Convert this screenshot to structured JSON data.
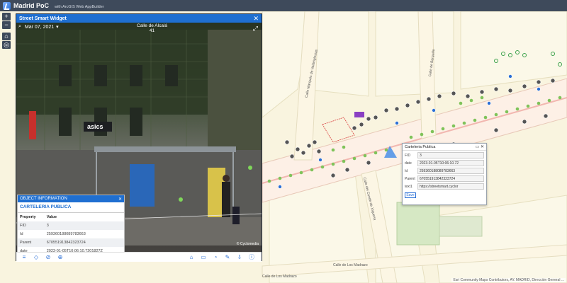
{
  "header": {
    "title": "Madrid PoC",
    "subtitle": "with ArcGIS Web AppBuilder"
  },
  "map_tools": {
    "zoom_in": "+",
    "zoom_out": "−",
    "home": "⌂",
    "locate": "◎"
  },
  "map": {
    "street_labels": [
      "Calle Marqués de Valdeiglesias",
      "Calle de Barquillo",
      "Calle de Alcalá",
      "Calle del Conde de Xiquena",
      "Calle de Los Madrazo",
      "Calle de Los Madrazo"
    ],
    "attribution": "Esri Community Maps Contributors, AY. MADRID, Dirección General ..."
  },
  "widget": {
    "title": "Street Smart Widget",
    "close": "✕",
    "date": "Mar 07, 2021",
    "address_line1": "Calle de Alcalá",
    "address_line2": "41",
    "copyright": "© Cyclomedia",
    "toolbar_left": [
      "≡",
      "◇",
      "⊘",
      "⊕"
    ],
    "toolbar_right": [
      "⌂",
      "▭",
      "◔",
      "✎",
      "⇩",
      "ⓘ"
    ]
  },
  "object_info": {
    "title": "OBJECT INFORMATION",
    "close": "✕",
    "subtitle": "CARTELERIA PUBLICA",
    "headers": [
      "Property",
      "Value"
    ],
    "rows": [
      [
        "FID",
        "3"
      ],
      [
        "Id",
        "259360188089783663"
      ],
      [
        "Parent",
        "670551913842323724"
      ],
      [
        "date",
        "2023-01-05T10:06:10.7201827Z"
      ]
    ]
  },
  "popup": {
    "title": "Carteleria Publica",
    "controls": "▭ ✕",
    "rows": [
      [
        "FID",
        "3"
      ],
      [
        "date",
        "2023-01-05T10:06:10.72"
      ],
      [
        "Id",
        "259360188089783663"
      ],
      [
        "Parent",
        "670551913842323724"
      ],
      [
        "text1",
        "https://streetsmart.cyclor"
      ]
    ],
    "save_label": "Save"
  },
  "colors": {
    "header_bg": "#3e4a5b",
    "accent": "#1f6fd1",
    "map_bg": "#f9f4df"
  }
}
